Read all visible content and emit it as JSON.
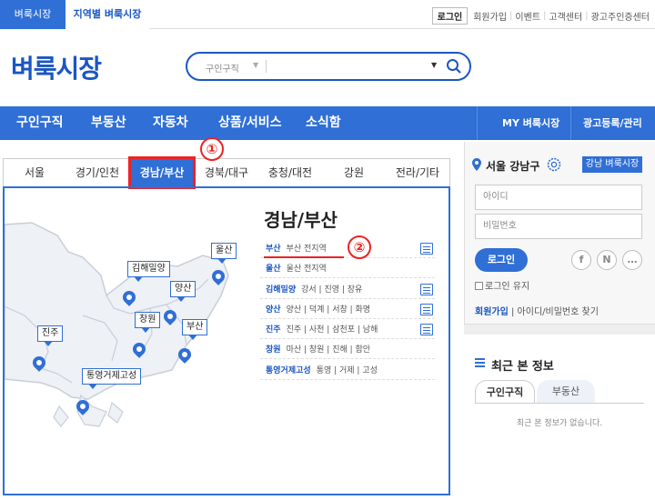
{
  "top": {
    "tab1": "벼룩시장",
    "tab2": "지역별 벼룩시장",
    "login": "로그인",
    "links": [
      "회원가입",
      "이벤트",
      "고객센터",
      "광고주인증센터"
    ]
  },
  "header": {
    "logo": "벼룩시장",
    "search_category": "구인구직"
  },
  "nav": {
    "items": [
      "구인구직",
      "부동산",
      "자동차",
      "상품/서비스",
      "소식함"
    ],
    "my": "MY 벼룩시장",
    "ad": "광고등록/관리"
  },
  "regions": [
    "서울",
    "경기/인천",
    "경남/부산",
    "경북/대구",
    "충청/대전",
    "강원",
    "전라/기타"
  ],
  "selected_region": "경남/부산",
  "panel": {
    "title": "경남/부산",
    "rows": [
      {
        "city": "부산",
        "subs": "부산 전지역"
      },
      {
        "city": "울산",
        "subs": "울산 전지역"
      },
      {
        "city": "김해밀양",
        "subs": "강서 | 진영 | 장유"
      },
      {
        "city": "양산",
        "subs": "양산 | 덕계 | 서창 | 화명"
      },
      {
        "city": "진주",
        "subs": "진주 | 사천 | 삼천포 | 남해"
      },
      {
        "city": "창원",
        "subs": "마산 | 창원 | 진해 | 함안"
      },
      {
        "city": "통영거제고성",
        "subs": "통영 | 거제 | 고성"
      }
    ]
  },
  "map_labels": [
    "울산",
    "김해밀양",
    "양산",
    "창원",
    "부산",
    "진주",
    "통영거제고성"
  ],
  "annotations": [
    "①",
    "②"
  ],
  "sidebar": {
    "location": "서울 강남구",
    "loc_button": "강남 벼룩시장",
    "id_placeholder": "아이디",
    "pw_placeholder": "비밀번호",
    "login": "로그인",
    "social": [
      "f",
      "N",
      "…"
    ],
    "keep": "로그인 유지",
    "join": "회원가입",
    "find": "아이디/비밀번호 찾기",
    "recent_title": "최근 본 정보",
    "recent_tabs": [
      "구인구직",
      "부동산"
    ],
    "empty": "최근 본 정보가 없습니다."
  },
  "colors": {
    "brand": "#2f6fd6",
    "annotation": "#e22222"
  }
}
